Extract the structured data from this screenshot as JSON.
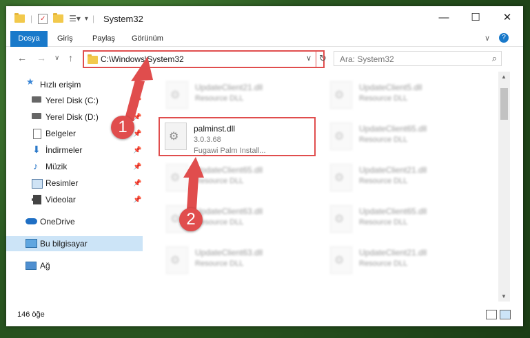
{
  "window": {
    "title": "System32"
  },
  "ribbon": {
    "tabs": [
      "Dosya",
      "Giriş",
      "Paylaş",
      "Görünüm"
    ]
  },
  "address": {
    "path": "C:\\Windows\\System32"
  },
  "search": {
    "placeholder": "Ara: System32"
  },
  "nav": {
    "items": [
      {
        "label": "Hızlı erişim",
        "icon": "star-icon"
      },
      {
        "label": "Yerel Disk (C:)",
        "icon": "drive-icon"
      },
      {
        "label": "Yerel Disk (D:)",
        "icon": "drive-icon"
      },
      {
        "label": "Belgeler",
        "icon": "documents-icon"
      },
      {
        "label": "İndirmeler",
        "icon": "download-icon"
      },
      {
        "label": "Müzik",
        "icon": "music-icon"
      },
      {
        "label": "Resimler",
        "icon": "pictures-icon"
      },
      {
        "label": "Videolar",
        "icon": "video-icon"
      },
      {
        "label": "OneDrive",
        "icon": "cloud-icon"
      },
      {
        "label": "Bu bilgisayar",
        "icon": "computer-icon"
      },
      {
        "label": "Ağ",
        "icon": "network-icon"
      }
    ]
  },
  "selected_file": {
    "name": "palminst.dll",
    "version": "3.0.3.68",
    "description": "Fugawi Palm Install..."
  },
  "blurred_files": [
    {
      "name": "UpdateClient21.dll",
      "type": "Resource DLL"
    },
    {
      "name": "UpdateClient5.dll",
      "type": "Resource DLL"
    },
    {
      "name": "UpdateClient65.dll",
      "type": "Resource DLL"
    },
    {
      "name": "UpdateClient65.dll",
      "type": "Resource DLL"
    },
    {
      "name": "UpdateClient21.dll",
      "type": "Resource DLL"
    },
    {
      "name": "UpdateClient63.dll",
      "type": "Resource DLL"
    },
    {
      "name": "UpdateClient65.dll",
      "type": "Resource DLL"
    },
    {
      "name": "UpdateClient63.dll",
      "type": "Resource DLL"
    },
    {
      "name": "UpdateClient21.dll",
      "type": "Resource DLL"
    }
  ],
  "status": {
    "count": "146 öğe"
  },
  "badges": [
    "1",
    "2"
  ],
  "colors": {
    "accent": "#1979ca",
    "highlight": "#e04d4d"
  }
}
